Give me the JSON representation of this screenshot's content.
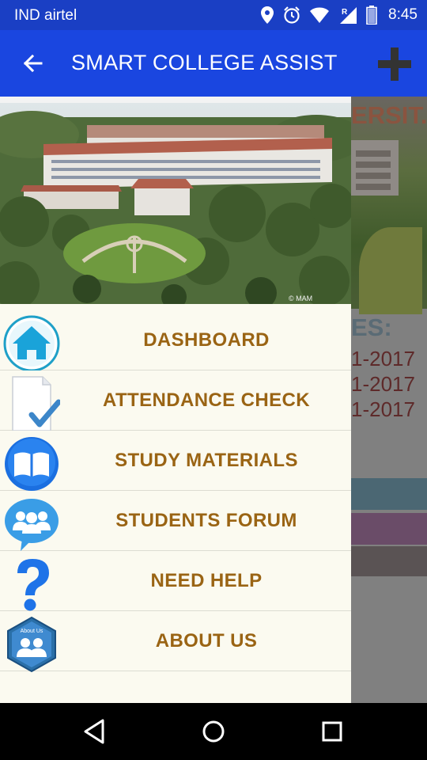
{
  "status_bar": {
    "carrier": "IND airtel",
    "time": "8:45",
    "icons": [
      "location-icon",
      "alarm-icon",
      "wifi-icon",
      "signal-roaming-icon",
      "battery-icon"
    ]
  },
  "app_bar": {
    "title": "SMART COLLEGE ASSIST",
    "back_icon": "arrow-back-icon",
    "action_icon": "plus-icon",
    "color": "#1a46e0"
  },
  "background_content": {
    "heading": "ERSIT..",
    "label": "ES:",
    "dates": [
      "1-2017",
      "1-2017",
      "1-2017"
    ]
  },
  "drawer": {
    "header_image": "college-campus-aerial-photo",
    "watermark": "© MAM",
    "menu_items": [
      {
        "label": "DASHBOARD",
        "icon": "home-icon"
      },
      {
        "label": "ATTENDANCE CHECK",
        "icon": "document-check-icon"
      },
      {
        "label": "STUDY MATERIALS",
        "icon": "book-icon"
      },
      {
        "label": "STUDENTS FORUM",
        "icon": "group-chat-icon"
      },
      {
        "label": "NEED HELP",
        "icon": "question-mark-icon"
      },
      {
        "label": "ABOUT US",
        "icon": "about-us-icon",
        "icon_caption": "About Us"
      }
    ],
    "label_color": "#9a6414"
  },
  "nav_bar": {
    "buttons": [
      "back-triangle-icon",
      "home-circle-icon",
      "recents-square-icon"
    ]
  }
}
